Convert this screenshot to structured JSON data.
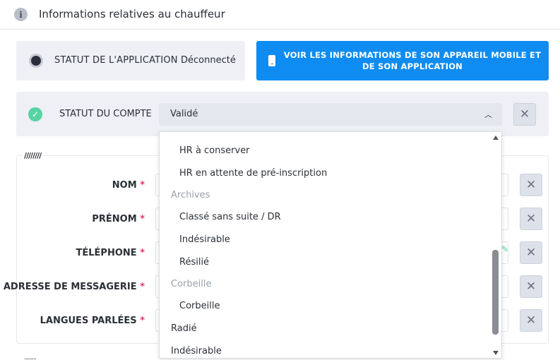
{
  "header": {
    "title": "Informations relatives au chauffeur",
    "icon": "info-icon"
  },
  "app_status": {
    "label": "STATUT DE L'APPLICATION",
    "value": "Déconnecté"
  },
  "mobile_button": {
    "label": "VOIR LES INFORMATIONS DE SON APPAREIL MOBILE ET DE SON APPLICATION",
    "color": "#0f8cf2"
  },
  "account_status": {
    "label": "STATUT DU COMPTE",
    "value": "Validé",
    "check_color": "#58d3a4"
  },
  "form": {
    "fields": [
      {
        "label": "NOM",
        "required": "*"
      },
      {
        "label": "PRÉNOM",
        "required": "*"
      },
      {
        "label": "TÉLÉPHONE",
        "required": "*"
      },
      {
        "label": "ADRESSE DE MESSAGERIE",
        "required": "*"
      },
      {
        "label": "LANGUES PARLÉES",
        "required": "*"
      }
    ]
  },
  "dropdown": {
    "items": [
      {
        "kind": "option",
        "label": "HR à conserver"
      },
      {
        "kind": "option",
        "label": "HR en attente de pré-inscription"
      },
      {
        "kind": "group",
        "label": "Archives"
      },
      {
        "kind": "option",
        "label": "Classé sans suite / DR"
      },
      {
        "kind": "option",
        "label": "Indésirable"
      },
      {
        "kind": "option",
        "label": "Résilié"
      },
      {
        "kind": "group",
        "label": "Corbeille"
      },
      {
        "kind": "option",
        "label": "Corbeille"
      },
      {
        "kind": "top",
        "label": "Radié"
      },
      {
        "kind": "top",
        "label": "Indésirable"
      }
    ]
  }
}
